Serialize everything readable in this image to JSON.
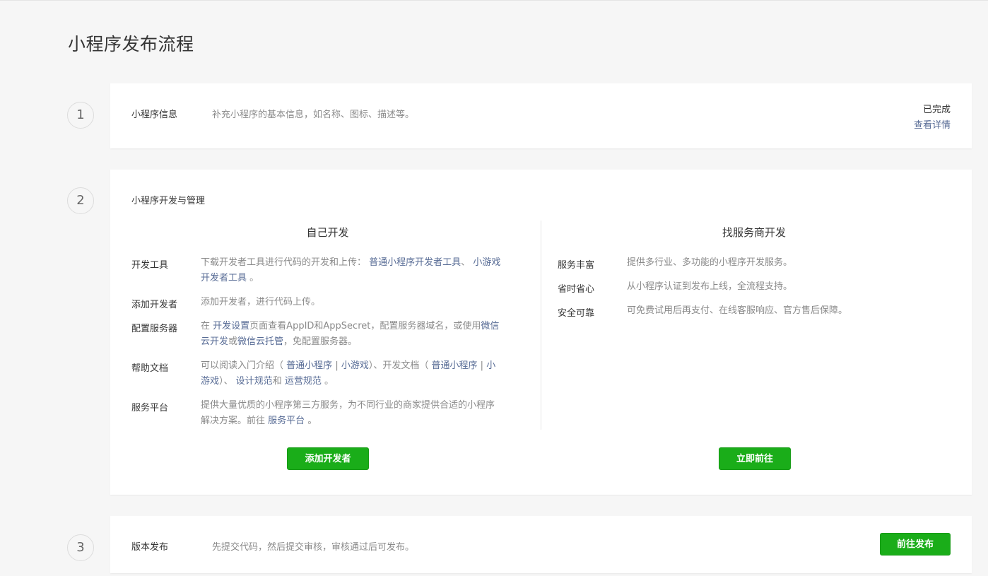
{
  "page_title": "小程序发布流程",
  "steps": [
    {
      "number": "1",
      "label": "小程序信息",
      "desc": "补充小程序的基本信息，如名称、图标、描述等。",
      "status": "已完成",
      "detail_link": "查看详情"
    },
    {
      "number": "2",
      "label": "小程序开发与管理",
      "self_dev": {
        "title": "自己开发",
        "rows": [
          {
            "label": "开发工具",
            "parts": [
              "下载开发者工具进行代码的开发和上传：",
              "普通小程序开发者工具",
              "、",
              "小游戏",
              "开发者工具",
              "。"
            ]
          },
          {
            "label": "添加开发者",
            "parts": [
              "添加开发者，进行代码上传。"
            ]
          },
          {
            "label": "配置服务器",
            "parts": [
              "在",
              "开发设置",
              "页面查看AppID和AppSecret，配置服务器域名，或使用",
              "微信",
              "云开发",
              "或",
              "微信云托管",
              "，免配置服务器。"
            ]
          },
          {
            "label": "帮助文档",
            "parts": [
              "可以阅读入门介绍（",
              "普通小程序",
              "|",
              "小游戏",
              "）、开发文档（",
              "普通小程序",
              "|",
              "小",
              "游戏",
              "）、",
              "设计规范",
              "和",
              "运营规范",
              "。"
            ]
          },
          {
            "label": "服务平台",
            "parts": [
              "提供大量优质的小程序第三方服务，为不同行业的商家提供合适的小程序",
              "解决方案。前往",
              "服务平台",
              "。"
            ]
          }
        ],
        "button": "添加开发者"
      },
      "vendor_dev": {
        "title": "找服务商开发",
        "rows": [
          {
            "label": "服务丰富",
            "text": "提供多行业、多功能的小程序开发服务。"
          },
          {
            "label": "省时省心",
            "text": "从小程序认证到发布上线，全流程支持。"
          },
          {
            "label": "安全可靠",
            "text": "可免费试用后再支付、在线客服响应、官方售后保障。"
          }
        ],
        "button": "立即前往"
      }
    },
    {
      "number": "3",
      "label": "版本发布",
      "desc": "先提交代码，然后提交审核，审核通过后可发布。",
      "button": "前往发布"
    }
  ]
}
